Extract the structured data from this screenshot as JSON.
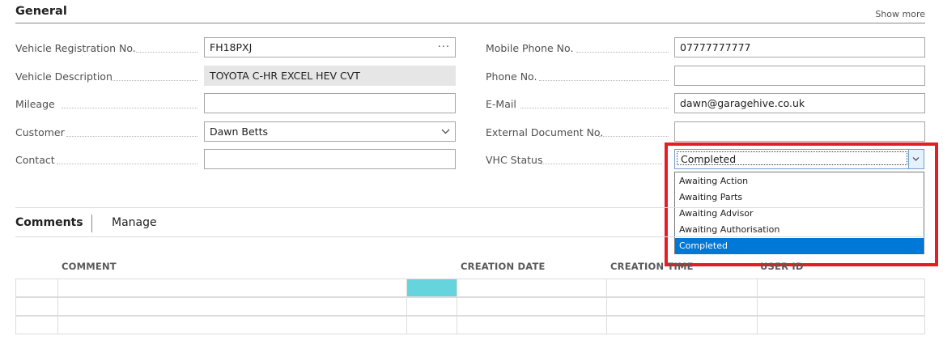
{
  "section": {
    "title": "General",
    "show_more": "Show more"
  },
  "left_fields": [
    {
      "label": "Vehicle Registration No.",
      "value": "FH18PXJ",
      "kind": "lookup"
    },
    {
      "label": "Vehicle Description",
      "value": "TOYOTA C-HR EXCEL HEV CVT",
      "kind": "readonly"
    },
    {
      "label": "Mileage",
      "value": "",
      "kind": "text"
    },
    {
      "label": "Customer",
      "value": "Dawn Betts",
      "kind": "dropdown"
    },
    {
      "label": "Contact",
      "value": "",
      "kind": "text"
    }
  ],
  "right_fields": [
    {
      "label": "Mobile Phone No.",
      "value": "07777777777"
    },
    {
      "label": "Phone No.",
      "value": ""
    },
    {
      "label": "E-Mail",
      "value": "dawn@garagehive.co.uk"
    },
    {
      "label": "External Document No.",
      "value": ""
    }
  ],
  "vhc": {
    "label": "VHC Status",
    "selected": "Completed",
    "options": [
      "Awaiting Action",
      "Awaiting Parts",
      "Awaiting Advisor",
      "Awaiting Authorisation",
      "Completed"
    ],
    "highlight_color": "#e51d25",
    "selection_color": "#0078d7"
  },
  "comments": {
    "tab_label": "Comments",
    "manage_label": "Manage",
    "columns": [
      "COMMENT",
      "CREATION DATE",
      "CREATION TIME",
      "USER ID"
    ],
    "accent_color": "#66d4dc"
  },
  "icons": {
    "lookup": "ellipsis-icon",
    "dropdown": "chevron-down-icon"
  }
}
